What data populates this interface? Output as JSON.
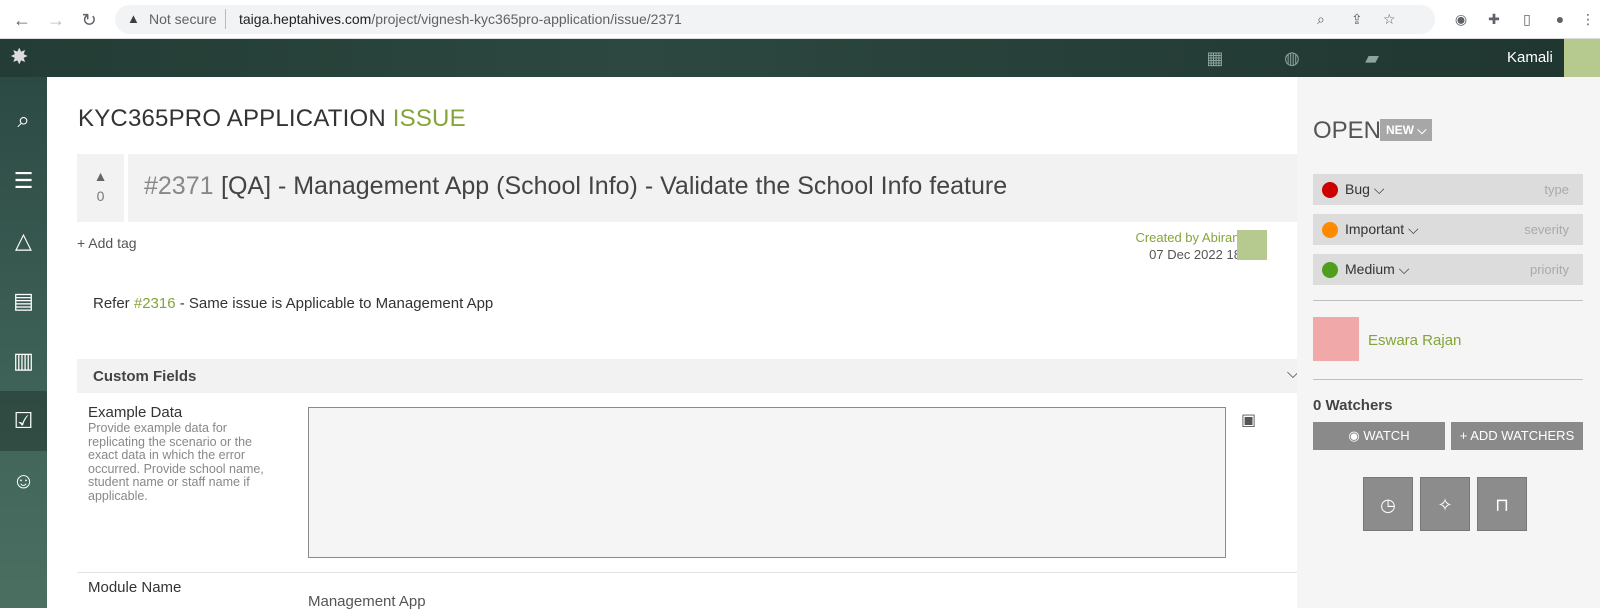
{
  "browser": {
    "not_secure": "Not secure",
    "url_host": "taiga.heptahives.com",
    "url_path": "/project/vignesh-kyc365pro-application/issue/2371"
  },
  "topbar": {
    "user_name": "Kamali"
  },
  "page": {
    "project": "KYC365PRO APPLICATION",
    "section": "ISSUE"
  },
  "issue": {
    "votes": "0",
    "ref": "#2371",
    "subject": "[QA] - Management App (School Info) - Validate the School Info feature",
    "add_tag": "Add tag",
    "created_by": "Created by Abirami N",
    "created_date": "07 Dec 2022 18:01",
    "description_prefix": "Refer",
    "description_link": "#2316",
    "description_suffix": "- Same issue is Applicable to Management App"
  },
  "custom_fields": {
    "title": "Custom Fields",
    "example_label": "Example Data",
    "example_help": "Provide example data for replicating the scenario or the exact data in which the error occurred. Provide school name, student name or staff name if applicable.",
    "module_label": "Module Name",
    "module_value": "Management App"
  },
  "sidebar": {
    "status": "OPEN",
    "status_badge": "NEW",
    "type_value": "Bug",
    "type_label": "type",
    "severity_value": "Important",
    "severity_label": "severity",
    "priority_value": "Medium",
    "priority_label": "priority",
    "assignee": "Eswara Rajan",
    "watchers": "0 Watchers",
    "watch_btn": "WATCH",
    "add_watchers_btn": "+ ADD WATCHERS"
  },
  "colors": {
    "accent": "#83a539",
    "bug": "#cc0000",
    "important": "#ff8a00",
    "medium": "#4f9e1c"
  }
}
